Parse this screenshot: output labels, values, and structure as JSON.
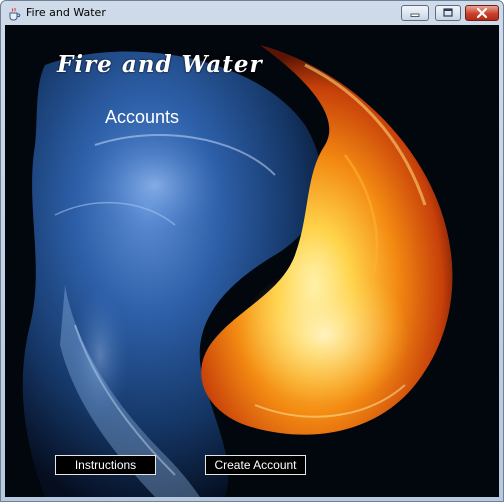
{
  "window": {
    "title": "Fire and Water"
  },
  "icons": {
    "app": "java-coffee-cup-icon",
    "minimize": "minimize-icon",
    "maximize": "maximize-icon",
    "close": "close-icon"
  },
  "screen": {
    "game_title": "Fire and Water",
    "subtitle": "Accounts"
  },
  "buttons": {
    "instructions": "Instructions",
    "create_account": "Create Account"
  },
  "colors": {
    "background": "#02060d",
    "water": "#2f6fc4",
    "fire": "#f08a12",
    "button_border": "#e6e6e6",
    "text": "#ffffff"
  }
}
